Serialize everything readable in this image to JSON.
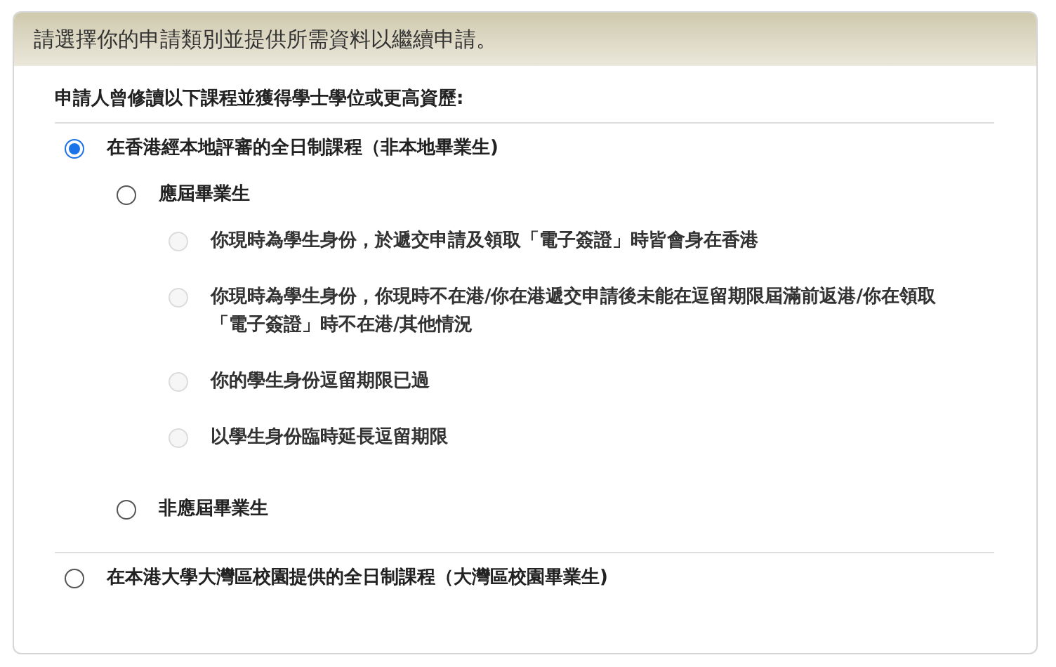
{
  "header": {
    "title": "請選擇你的申請類別並提供所需資料以繼續申請。"
  },
  "question": "申請人曾修讀以下課程並獲得學士學位或更高資歷:",
  "options": [
    {
      "label": "在香港經本地評審的全日制課程（非本地畢業生)",
      "selected": true,
      "disabled": false,
      "children": [
        {
          "label": "應屆畢業生",
          "selected": false,
          "disabled": false,
          "children": [
            {
              "label": "你現時為學生身份，於遞交申請及領取「電子簽證」時皆會身在香港",
              "selected": false,
              "disabled": true
            },
            {
              "label": "你現時為學生身份，你現時不在港/你在港遞交申請後未能在逗留期限屆滿前返港/你在領取「電子簽證」時不在港/其他情況",
              "selected": false,
              "disabled": true
            },
            {
              "label": "你的學生身份逗留期限已過",
              "selected": false,
              "disabled": true
            },
            {
              "label": "以學生身份臨時延長逗留期限",
              "selected": false,
              "disabled": true
            }
          ]
        },
        {
          "label": "非應屆畢業生",
          "selected": false,
          "disabled": false
        }
      ]
    },
    {
      "label": "在本港大學大灣區校園提供的全日制課程（大灣區校園畢業生)",
      "selected": false,
      "disabled": false
    }
  ]
}
